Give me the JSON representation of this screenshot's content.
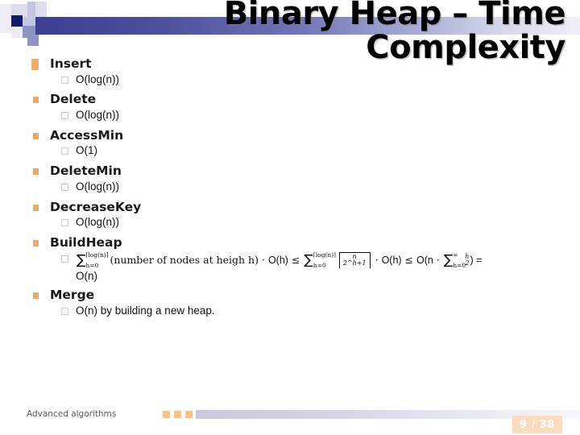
{
  "slide": {
    "title": "Binary Heap – Time Complexity",
    "title_line1": "Binary Heap – Time",
    "title_line2": "Complexity"
  },
  "operations": [
    {
      "name": "Insert",
      "complexity": "O(log(n))"
    },
    {
      "name": "Delete",
      "complexity": "O(log(n))"
    },
    {
      "name": "AccessMin",
      "complexity": "O(1)"
    },
    {
      "name": "DeleteMin",
      "complexity": "O(log(n))"
    },
    {
      "name": "DecreaseKey",
      "complexity": "O(log(n))"
    },
    {
      "name": "BuildHeap",
      "complexity": "O(n)"
    },
    {
      "name": "Merge",
      "complexity": "O(n) by building a new heap."
    }
  ],
  "buildheap_formula": {
    "full_text": "∑_{h=0}^{⌈log(n)⌉}(number of nodes at heigh h) · O(h) ≤ ∑_{h=0}^{⌈log(n)⌉} ⌈n/2^{h+1}⌉ · O(h) ≤ O(n · ∑_{h=0}^{∞} h/2^h) =",
    "sum1_upper": "⌈log(n)⌉",
    "sum1_lower": "h=0",
    "phrase": "(number of nodes at heigh h)",
    "dot": "·",
    "oh_1": "O(h)",
    "leq_1": "≤",
    "sum2_upper": "⌈log(n)⌉",
    "sum2_lower": "h=0",
    "ceil_num": "n",
    "ceil_den": "2^h+1",
    "ceil_den_base": "2",
    "ceil_den_exp": "h+1",
    "oh_2": "O(h)",
    "leq_2": "≤",
    "o_open": "O(n",
    "dot2": "·",
    "sum3_upper": "∞",
    "sum3_lower": "h=0",
    "frac2_num": "h",
    "frac2_den_base": "2",
    "frac2_den_exp": "h",
    "o_close": ") =",
    "result": "O(n)"
  },
  "footer": {
    "course": "Advanced algorithms",
    "page": "9 / 38"
  },
  "colors": {
    "accent_orange": "#f0a860",
    "badge_bg": "#fbdcbe",
    "band_navy": "#131a6b",
    "band_blue": "#4a4f9e"
  }
}
